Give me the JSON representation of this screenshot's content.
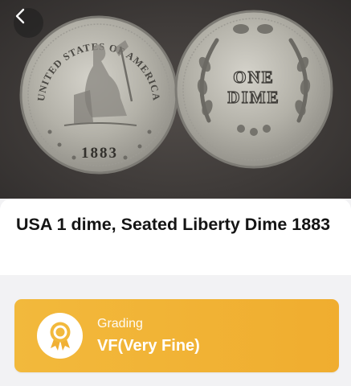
{
  "coin": {
    "title": "USA 1 dime, Seated Liberty Dime 1883"
  },
  "photo": {
    "obverse_legend": "UNITED STATES OF AMERICA",
    "obverse_year": "1883",
    "reverse_legend_line1": "ONE",
    "reverse_legend_line2": "DIME"
  },
  "grading": {
    "label": "Grading",
    "value": "VF(Very Fine)",
    "accent": "#f0b035"
  },
  "icons": {
    "back": "chevron-left-icon",
    "badge": "award-ribbon-icon"
  }
}
